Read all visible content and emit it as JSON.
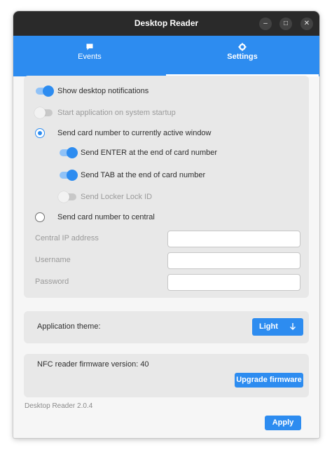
{
  "window": {
    "title": "Desktop Reader",
    "controls": {
      "minimize_icon": "minimize-icon",
      "maximize_icon": "maximize-icon",
      "close_icon": "close-icon"
    }
  },
  "tabs": [
    {
      "label": "Events",
      "icon": "chat-bubble-icon",
      "active": false
    },
    {
      "label": "Settings",
      "icon": "gear-icon",
      "active": true
    }
  ],
  "settings": {
    "show_notifications": {
      "label": "Show desktop notifications",
      "on": true,
      "enabled": true
    },
    "startup": {
      "label": "Start application on system startup",
      "on": false,
      "enabled": false
    },
    "mode_active_window": {
      "label": "Send card number to currently active window",
      "selected": true
    },
    "send_enter": {
      "label": "Send ENTER at the end of card number",
      "on": true,
      "enabled": true
    },
    "send_tab": {
      "label": "Send TAB at the end of card number",
      "on": true,
      "enabled": true
    },
    "send_locker": {
      "label": "Send Locker Lock ID",
      "on": false,
      "enabled": false
    },
    "mode_central": {
      "label": "Send card number to central",
      "selected": false
    },
    "central_ip": {
      "label": "Central IP address",
      "value": ""
    },
    "username": {
      "label": "Username",
      "value": ""
    },
    "password": {
      "label": "Password",
      "value": ""
    }
  },
  "theme": {
    "label": "Application theme:",
    "selected": "Light"
  },
  "firmware": {
    "label": "NFC reader firmware version: 40",
    "button": "Upgrade firmware"
  },
  "footer": {
    "version": "Desktop Reader 2.0.4",
    "apply": "Apply"
  },
  "colors": {
    "accent": "#2d8cf0",
    "titlebar": "#2a2a2a",
    "card": "#e8e8e8"
  }
}
